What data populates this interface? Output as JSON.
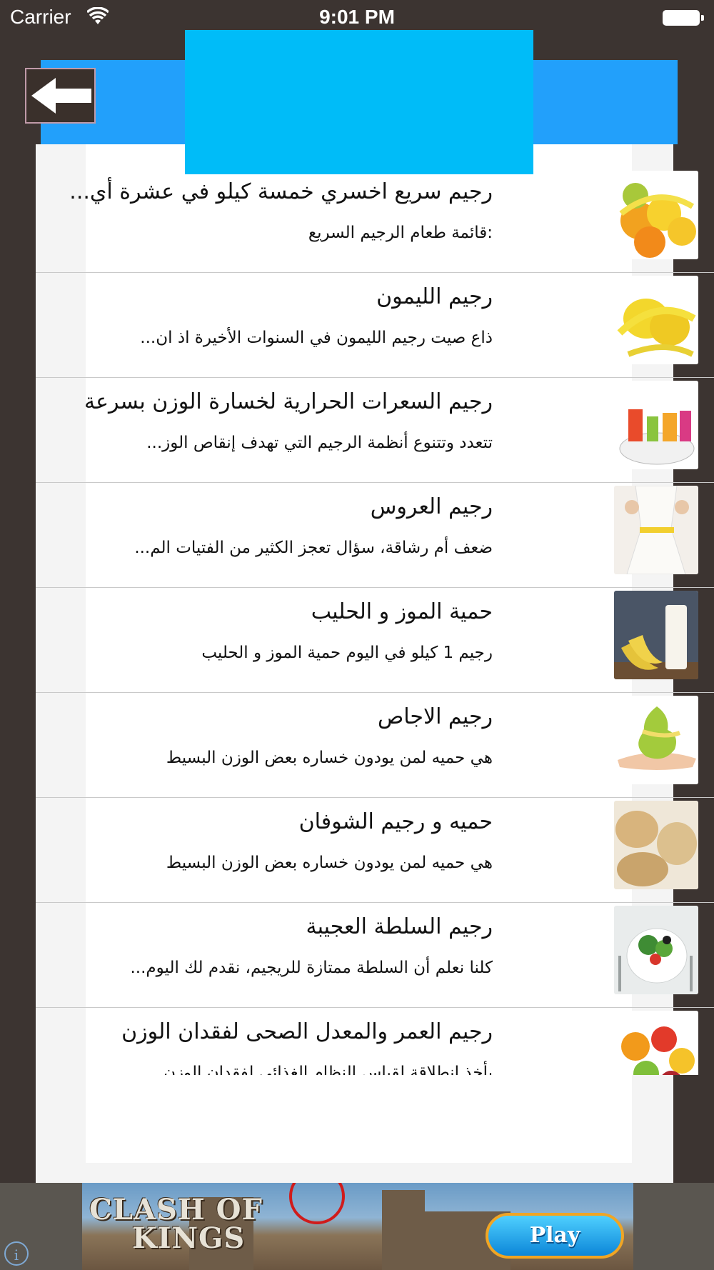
{
  "status_bar": {
    "carrier": "Carrier",
    "time": "9:01 PM",
    "wifi_icon": "wifi-icon",
    "battery_icon": "battery-icon"
  },
  "header": {
    "back_icon": "arrow-left-icon",
    "accent_color": "#22a0fb",
    "banner_color": "#00bcf8"
  },
  "list": {
    "items": [
      {
        "title": "رجيم سريع اخسري خمسة كيلو في عشرة أي...",
        "subtitle": ":قائمة طعام الرجيم السريع",
        "image": "fruits-measuring-tape-image"
      },
      {
        "title": "رجيم الليمون",
        "subtitle": "ذاع صيت رجيم الليمون في السنوات الأخيرة اذ ان...",
        "image": "lemons-measuring-tape-image"
      },
      {
        "title": "رجيم السعرات الحرارية لخسارة الوزن بسرعة",
        "subtitle": "تتعدد وتتنوع أنظمة الرجيم التي تهدف إنقاص الوز...",
        "image": "diet-letters-tape-image"
      },
      {
        "title": "رجيم العروس",
        "subtitle": "ضعف أم رشاقة، سؤال تعجز الكثير من الفتيات الم...",
        "image": "bride-waist-image"
      },
      {
        "title": "حمية الموز و الحليب",
        "subtitle": "رجيم 1 كيلو في اليوم حمية الموز و الحليب",
        "image": "banana-milk-image"
      },
      {
        "title": "رجيم الاجاص",
        "subtitle": "هي حميه لمن يودون خساره بعض الوزن البسيط",
        "image": "pear-hand-image"
      },
      {
        "title": "حميه و رجيم الشوفان",
        "subtitle": "هي حميه لمن يودون خساره بعض الوزن البسيط",
        "image": "oats-bowls-image"
      },
      {
        "title": "رجيم السلطة العجيبة",
        "subtitle": "كلنا نعلم أن السلطة ممتازة للريجيم، نقدم لك اليوم...",
        "image": "salad-bowl-image"
      },
      {
        "title": "رجيم العمر والمعدل الصحى لفقدان الوزن",
        "subtitle": "يأخذ إنطلاقة لقياس النظام الغذائي لفقدان الوزن",
        "image": "mixed-fruits-image"
      }
    ]
  },
  "ad": {
    "logo_line1": "CLASH OF",
    "logo_line2": "KINGS",
    "play_label": "Play",
    "info_icon": "info-icon"
  }
}
